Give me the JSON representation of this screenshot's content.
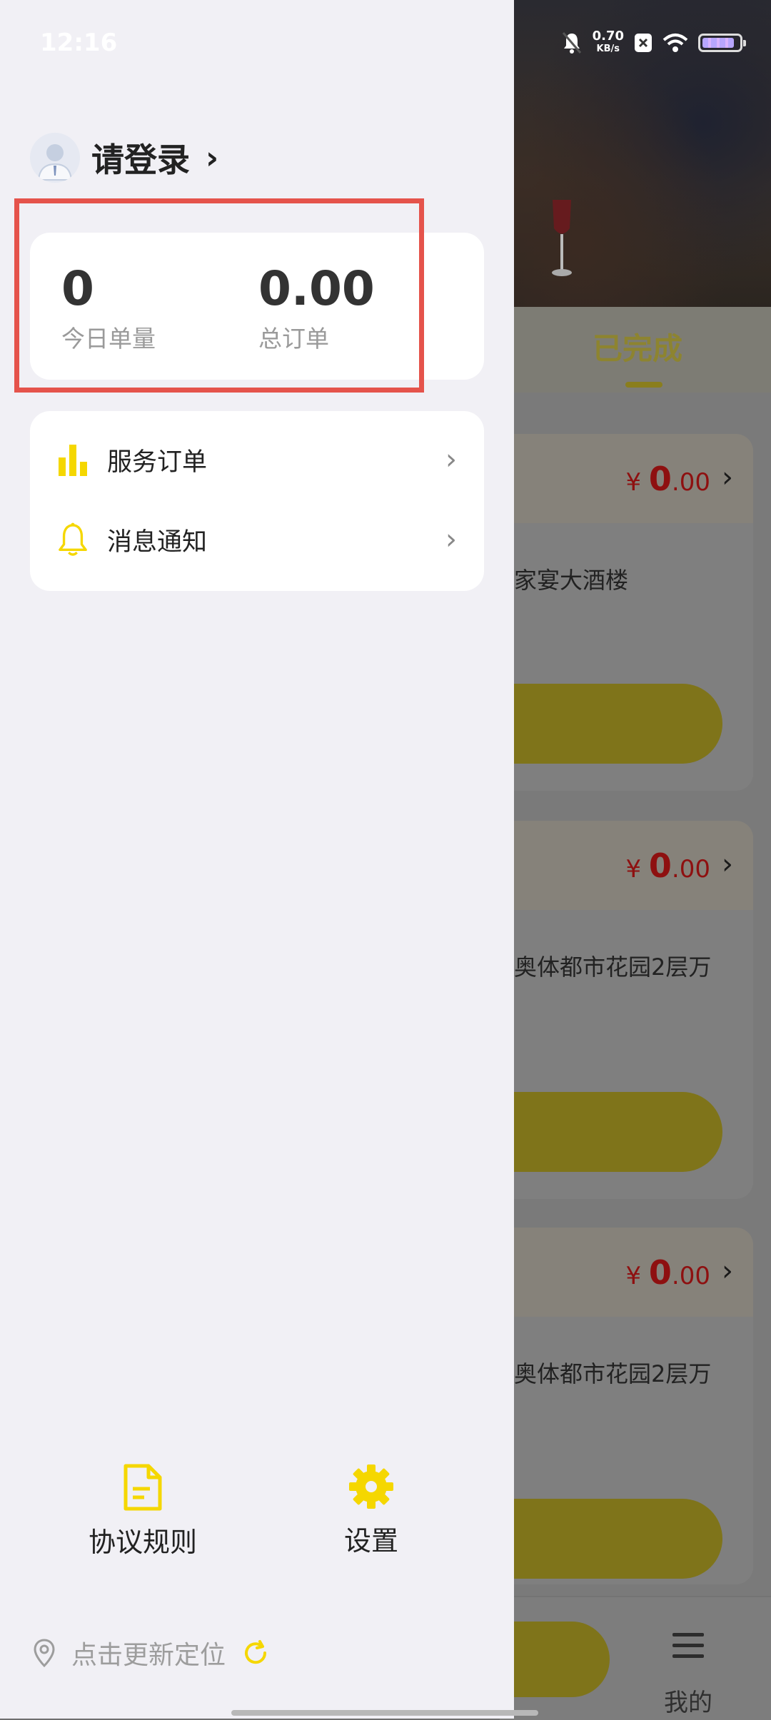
{
  "status_bar": {
    "time": "12:16",
    "network_speed_value": "0.70",
    "network_speed_unit": "KB/s",
    "icons": [
      "mute-bell-icon",
      "close-box-icon",
      "wifi-icon",
      "battery-icon"
    ]
  },
  "drawer": {
    "login_text": "请登录",
    "stats": {
      "today_count": "0",
      "today_label": "今日单量",
      "total_value": "0.00",
      "total_label": "总订单"
    },
    "menu": [
      {
        "label": "服务订单",
        "icon": "bar-chart-icon"
      },
      {
        "label": "消息通知",
        "icon": "bell-icon"
      }
    ],
    "actions": [
      {
        "label": "协议规则",
        "icon": "document-icon"
      },
      {
        "label": "设置",
        "icon": "gear-icon"
      }
    ],
    "location_text": "点击更新定位"
  },
  "background": {
    "tab_completed": "已完成",
    "orders": [
      {
        "currency": "¥",
        "price_int": "0",
        "price_dec": ".00",
        "address": "家宴大酒楼"
      },
      {
        "currency": "¥",
        "price_int": "0",
        "price_dec": ".00",
        "address": "奥体都市花园2层万"
      },
      {
        "currency": "¥",
        "price_int": "0",
        "price_dec": ".00",
        "address": "奥体都市花园2层万"
      }
    ],
    "tabbar_mine": "我的"
  },
  "colors": {
    "accent_yellow": "#f5d700",
    "highlight_red": "#e5534b",
    "price_red": "#c51313",
    "drawer_bg": "#f1f0f5"
  }
}
